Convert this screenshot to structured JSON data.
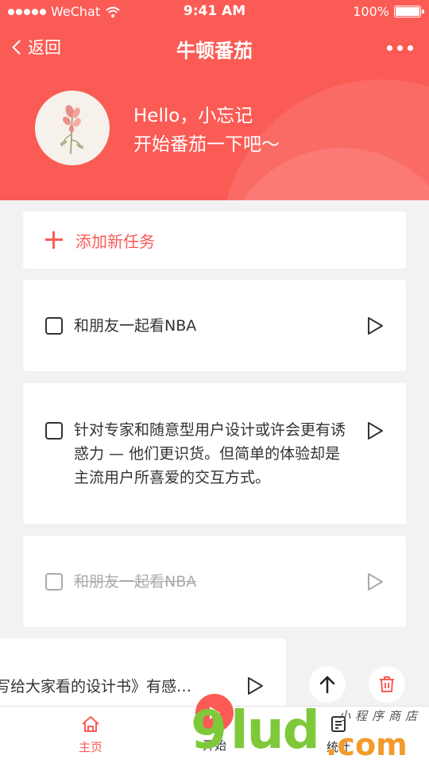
{
  "status_bar": {
    "carrier": "WeChat",
    "time": "9:41 AM",
    "battery": "100%",
    "battery_level": 1.0
  },
  "nav": {
    "back_label": "返回",
    "title": "牛顿番茄"
  },
  "profile": {
    "greeting_line1": "Hello，小忘记",
    "greeting_line2": "开始番茄一下吧～"
  },
  "add_task": {
    "label": "添加新任务"
  },
  "tasks": [
    {
      "text": "和朋友一起看NBA",
      "done": false
    },
    {
      "text": "针对专家和随意型用户设计或许会更有诱惑力 — 他们更识货。但简单的体验却是主流用户所喜爱的交互方式。",
      "done": false
    },
    {
      "text": "和朋友一起看NBA",
      "done": true
    }
  ],
  "swiped_task": {
    "text": "写给大家看的设计书》有感…"
  },
  "tabbar": {
    "home_label": "主页",
    "start_label": "开始",
    "stats_label": "统计"
  },
  "watermark": {
    "brand": "9lud",
    "domain": ".com",
    "tagline": "小程序商店"
  },
  "colors": {
    "accent": "#fb5b55",
    "background": "#f2f2f2",
    "text": "#333333",
    "done_text": "#aaaaaa"
  }
}
